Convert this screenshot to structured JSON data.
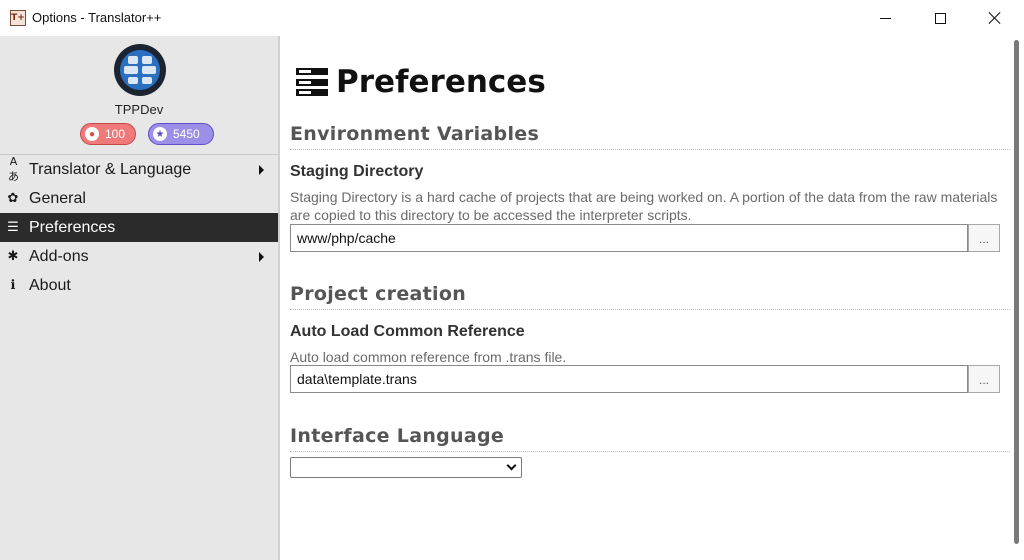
{
  "window": {
    "icon_label": "T+",
    "title": "Options - Translator++"
  },
  "profile": {
    "username": "TPPDev",
    "badge_red_value": "100",
    "badge_blue_value": "5450"
  },
  "sidebar": {
    "items": [
      {
        "label": "Translator & Language",
        "icon": "translate-icon",
        "icon_glyph": "Aあ",
        "has_submenu": true,
        "active": false
      },
      {
        "label": "General",
        "icon": "gear-icon",
        "icon_glyph": "✿",
        "has_submenu": false,
        "active": false
      },
      {
        "label": "Preferences",
        "icon": "preferences-icon",
        "icon_glyph": "☰",
        "has_submenu": false,
        "active": true
      },
      {
        "label": "Add-ons",
        "icon": "puzzle-icon",
        "icon_glyph": "✱",
        "has_submenu": true,
        "active": false
      },
      {
        "label": "About",
        "icon": "info-icon",
        "icon_glyph": "ℹ",
        "has_submenu": false,
        "active": false
      }
    ]
  },
  "main": {
    "page_title": "Preferences",
    "sections": [
      {
        "heading": "Environment Variables",
        "field_title": "Staging Directory",
        "description": "Staging Directory is a hard cache of projects that are being worked on. A portion of the data from the raw materials are copied to this directory to be accessed the interpreter scripts.",
        "value": "www/php/cache",
        "browse_label": "..."
      },
      {
        "heading": "Project creation",
        "field_title": "Auto Load Common Reference",
        "description": "Auto load common reference from .trans file.",
        "value": "data\\template.trans",
        "browse_label": "..."
      },
      {
        "heading": "Interface Language",
        "selected_value": ""
      }
    ]
  },
  "colors": {
    "sidebar_bg": "#e7e7e7",
    "active_item_bg": "#2b2b2b",
    "badge_red": "#f07a7a",
    "badge_blue": "#9b8fe8",
    "heading_text": "#555555"
  }
}
